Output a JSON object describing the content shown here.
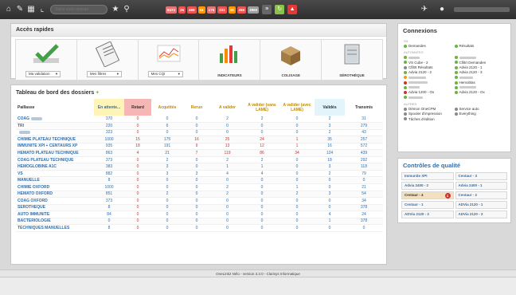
{
  "topbar": {
    "search_placeholder": "Saisir code dossier",
    "counters": [
      {
        "value": "8474",
        "color": "#e57373"
      },
      {
        "value": "26",
        "color": "#ef5350"
      },
      {
        "value": "469",
        "color": "#ef5350"
      },
      {
        "value": "84",
        "color": "#ff9800"
      },
      {
        "value": "176",
        "color": "#e57373"
      },
      {
        "value": "331",
        "color": "#ef5350"
      },
      {
        "value": "36",
        "color": "#ff9800"
      },
      {
        "value": "260",
        "color": "#ef5350"
      },
      {
        "value": "3960",
        "color": "#9e9e9e"
      }
    ]
  },
  "quick_access": {
    "title": "Accès rapides",
    "tiles": [
      {
        "kind": "select",
        "label": "Ma validation"
      },
      {
        "kind": "select",
        "label": "Mes filtres"
      },
      {
        "kind": "select",
        "label": "Mes CQI"
      },
      {
        "kind": "link",
        "label": "INDICATEURS"
      },
      {
        "kind": "link",
        "label": "COLISAGE"
      },
      {
        "kind": "link",
        "label": "SÉROTHÈQUE"
      }
    ]
  },
  "dashboard": {
    "title": "Tableau de bord des dossiers",
    "plus": "+",
    "columns": [
      "Paillasse",
      "En attente...",
      "Retard",
      "Acquittés",
      "Rerun",
      "A valider",
      "A valider (sans LAME)",
      "A valider (avec LAME)",
      "Validés",
      "Transmis"
    ],
    "rows": [
      [
        "COAG",
        "370",
        "0",
        "0",
        "0",
        "2",
        "2",
        "0",
        "2",
        "31"
      ],
      [
        "TRI",
        "220",
        "0",
        "6",
        "0",
        "0",
        "0",
        "0",
        "3",
        "279"
      ],
      [
        "",
        "323",
        "0",
        "0",
        "0",
        "0",
        "0",
        "0",
        "2",
        "43"
      ],
      [
        "CHIMIE PLATEAU TECHNIQUE",
        "1000",
        "15",
        "175",
        "16",
        "25",
        "24",
        "1",
        "35",
        "257"
      ],
      [
        "IMMUNITE XPI + CENTAURS XP",
        "935",
        "18",
        "191",
        "9",
        "13",
        "12",
        "1",
        "16",
        "572"
      ],
      [
        "HEMATO PLATEAU TECHNIQUE",
        "863",
        "4",
        "21",
        "7",
        "119",
        "86",
        "34",
        "124",
        "439"
      ],
      [
        "COAG PLATEAU TECHNIQUE",
        "373",
        "0",
        "2",
        "0",
        "2",
        "2",
        "0",
        "18",
        "292"
      ],
      [
        "HEMOGLOBINE A1C",
        "383",
        "0",
        "3",
        "0",
        "1",
        "1",
        "0",
        "3",
        "118"
      ],
      [
        "VS",
        "882",
        "0",
        "3",
        "3",
        "4",
        "4",
        "0",
        "2",
        "79"
      ],
      [
        "MANUELLE",
        "8",
        "0",
        "0",
        "0",
        "0",
        "0",
        "0",
        "0",
        "0"
      ],
      [
        "CHIMIE OXFORD",
        "1000",
        "0",
        "0",
        "0",
        "2",
        "0",
        "1",
        "0",
        "21"
      ],
      [
        "HEMATO OXFORD",
        "851",
        "0",
        "2",
        "0",
        "2",
        "0",
        "2",
        "3",
        "54"
      ],
      [
        "COAG OXFORD",
        "373",
        "0",
        "0",
        "0",
        "0",
        "0",
        "0",
        "0",
        "34"
      ],
      [
        "SEROTHEQUE",
        "8",
        "0",
        "0",
        "0",
        "0",
        "0",
        "0",
        "0",
        "378"
      ],
      [
        "AUTO IMMUNITE",
        "84",
        "0",
        "0",
        "0",
        "0",
        "0",
        "0",
        "4",
        "24"
      ],
      [
        "BACTERIOLOGIE",
        "0",
        "0",
        "0",
        "0",
        "0",
        "0",
        "0",
        "1",
        "378"
      ],
      [
        "TECHNIQUES MANUELLES",
        "8",
        "0",
        "0",
        "0",
        "0",
        "0",
        "0",
        "0",
        "0"
      ]
    ]
  },
  "connections": {
    "title": "Connexions",
    "groups": [
      {
        "title": "SIL",
        "items": [
          {
            "label": "Demandes",
            "status": "green"
          },
          {
            "label": "Résultats",
            "status": "green"
          }
        ]
      },
      {
        "title": "AUTOMATES",
        "items": [
          {
            "label": "",
            "status": "green"
          },
          {
            "label": "",
            "status": "green"
          },
          {
            "label": "VS Cube - 2",
            "status": "green"
          },
          {
            "label": "Cfiltrt Demandes",
            "status": "green"
          },
          {
            "label": "Cfiltrt Résultats",
            "status": "gray"
          },
          {
            "label": "Advia 2120 - 1",
            "status": "green"
          },
          {
            "label": "Advia 2120 - 2",
            "status": "green"
          },
          {
            "label": "Advia 2120 - 3",
            "status": "green"
          },
          {
            "label": "",
            "status": "orange"
          },
          {
            "label": "",
            "status": "green"
          },
          {
            "label": "",
            "status": "red"
          },
          {
            "label": "Hemoblas",
            "status": "green"
          },
          {
            "label": "",
            "status": "green"
          },
          {
            "label": "",
            "status": "green"
          },
          {
            "label": "Advia 1200 - Ox",
            "status": "red"
          },
          {
            "label": "Advia 2120 - Ox",
            "status": "green"
          },
          {
            "label": "",
            "status": "green"
          }
        ]
      },
      {
        "title": "AUTRES",
        "items": [
          {
            "label": "Démon OneCPM",
            "status": "gray"
          },
          {
            "label": "Service auto",
            "status": "gray"
          },
          {
            "label": "Spooler d'impression",
            "status": "gray"
          },
          {
            "label": "Everything",
            "status": "gray"
          },
          {
            "label": "Tâches d'édition",
            "status": "gray"
          }
        ]
      }
    ]
  },
  "quality": {
    "title": "Contrôles de qualité",
    "items": [
      {
        "label": "Immunite XPI",
        "warn": false
      },
      {
        "label": "Centaur - 3",
        "warn": false
      },
      {
        "label": "Advia 2400 - 2",
        "warn": false
      },
      {
        "label": "Advia 2400 - 1",
        "warn": false
      },
      {
        "label": "Centaur - 4",
        "warn": true,
        "badge": "1"
      },
      {
        "label": "Centaur - 2",
        "warn": false
      },
      {
        "label": "Centaur - 1",
        "warn": false
      },
      {
        "label": "ADVia 2120 - 1",
        "warn": false
      },
      {
        "label": "ADVia 2120 - 2",
        "warn": false
      },
      {
        "label": "ADVia 2120 - 3",
        "warn": false
      }
    ]
  },
  "footer": {
    "text": "OneLink2 Nélo - version 3.3.0 - Clarisys Informatique"
  }
}
